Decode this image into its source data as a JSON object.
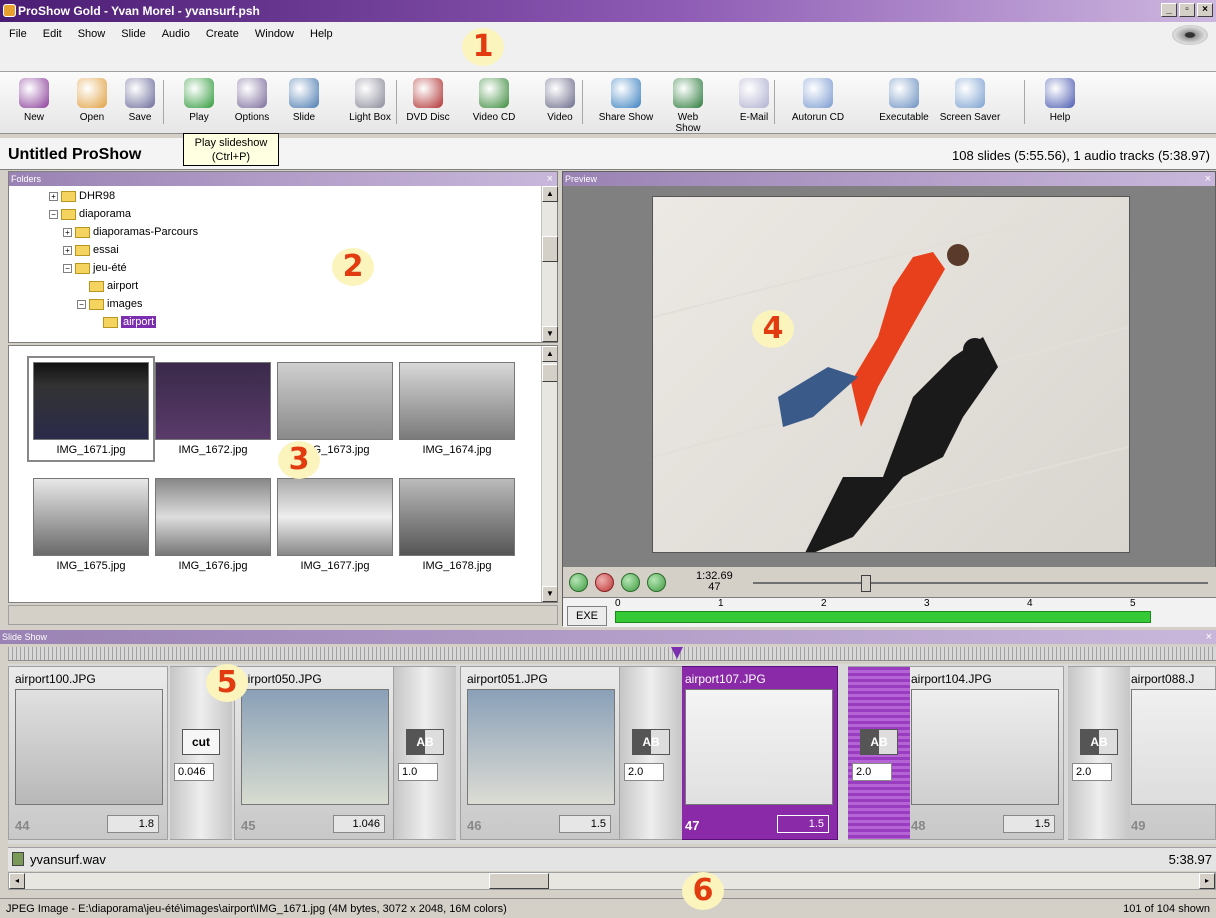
{
  "window": {
    "title": "ProShow Gold - Yvan Morel - yvansurf.psh",
    "minimize": "_",
    "maximize": "▫",
    "close": "×"
  },
  "menu": [
    "File",
    "Edit",
    "Show",
    "Slide",
    "Audio",
    "Create",
    "Window",
    "Help"
  ],
  "toolbar": [
    {
      "label": "New",
      "icon": "new-icon",
      "color": "#8a3d9a"
    },
    {
      "label": "Open",
      "icon": "open-icon",
      "color": "#e0a040"
    },
    {
      "label": "Save",
      "icon": "save-icon",
      "color": "#6a6a9a"
    },
    {
      "label": "Play",
      "icon": "play-icon",
      "color": "#2f9a3a"
    },
    {
      "label": "Options",
      "icon": "options-icon",
      "color": "#7a6a9a"
    },
    {
      "label": "Slide",
      "icon": "slide-icon",
      "color": "#4a7ab0"
    },
    {
      "label": "Light Box",
      "icon": "lightbox-icon",
      "color": "#8a8a9a"
    },
    {
      "label": "DVD Disc",
      "icon": "dvd-icon",
      "color": "#b03030"
    },
    {
      "label": "Video CD",
      "icon": "videocd-icon",
      "color": "#3a8a3a"
    },
    {
      "label": "Video",
      "icon": "video-icon",
      "color": "#6a6a8a"
    },
    {
      "label": "Share Show",
      "icon": "share-icon",
      "color": "#3a80c0"
    },
    {
      "label": "Web Show",
      "icon": "web-icon",
      "color": "#2a7a3a"
    },
    {
      "label": "E-Mail",
      "icon": "email-icon",
      "color": "#b0b0d0"
    },
    {
      "label": "Autorun CD",
      "icon": "autorun-icon",
      "color": "#7a9ad0"
    },
    {
      "label": "Executable",
      "icon": "exe-icon",
      "color": "#6a90c0"
    },
    {
      "label": "Screen Saver",
      "icon": "screensaver-icon",
      "color": "#7aa0d0"
    },
    {
      "label": "Help",
      "icon": "help-icon",
      "color": "#4a5ab0"
    }
  ],
  "tooltip": {
    "line1": "Play slideshow",
    "line2": "(Ctrl+P)"
  },
  "show": {
    "title": "Untitled ProShow",
    "info": "108 slides (5:55.56), 1 audio tracks (5:38.97)"
  },
  "folders": {
    "title": "Folders",
    "close": "×",
    "nodes": [
      {
        "label": "DHR98",
        "toggle": "+"
      },
      {
        "label": "diaporama",
        "toggle": "−"
      },
      {
        "label": "diaporamas-Parcours",
        "toggle": "+"
      },
      {
        "label": "essai",
        "toggle": "+"
      },
      {
        "label": "jeu-été",
        "toggle": "−"
      },
      {
        "label": "airport",
        "toggle": ""
      },
      {
        "label": "images",
        "toggle": "−"
      },
      {
        "label": "airport",
        "toggle": ""
      }
    ]
  },
  "thumbnails": [
    "IMG_1671.jpg",
    "IMG_1672.jpg",
    "IMG_1673.jpg",
    "IMG_1674.jpg",
    "IMG_1675.jpg",
    "IMG_1676.jpg",
    "IMG_1677.jpg",
    "IMG_1678.jpg"
  ],
  "preview": {
    "title": "Preview",
    "close": "×",
    "time": "1:32.69",
    "slide_number": "47",
    "exe_label": "EXE",
    "ruler": [
      "0",
      "1",
      "2",
      "3",
      "4",
      "5"
    ]
  },
  "slideshow": {
    "title": "Slide Show",
    "close": "×",
    "slides": [
      {
        "name": "airport100.JPG",
        "number": "44",
        "duration": "1.8"
      },
      {
        "name": "airport050.JPG",
        "number": "45",
        "duration": "1.046"
      },
      {
        "name": "airport051.JPG",
        "number": "46",
        "duration": "1.5"
      },
      {
        "name": "airport107.JPG",
        "number": "47",
        "duration": "1.5"
      },
      {
        "name": "airport104.JPG",
        "number": "48",
        "duration": "1.5"
      },
      {
        "name": "airport088.J",
        "number": "49",
        "duration": ""
      }
    ],
    "transitions": [
      {
        "label": "cut",
        "duration": "0.046"
      },
      {
        "label": "AB",
        "duration": "1.0"
      },
      {
        "label": "AB",
        "duration": "2.0"
      },
      {
        "label": "AB",
        "duration": "2.0"
      },
      {
        "label": "AB",
        "duration": "2.0"
      }
    ]
  },
  "audio": {
    "file": "yvansurf.wav",
    "length": "5:38.97"
  },
  "status": {
    "left": "JPEG Image - E:\\diaporama\\jeu-été\\images\\airport\\IMG_1671.jpg  (4M bytes, 3072 x 2048, 16M colors)",
    "right": "101 of 104 shown"
  },
  "callouts": [
    "1",
    "2",
    "3",
    "4",
    "5",
    "6"
  ]
}
